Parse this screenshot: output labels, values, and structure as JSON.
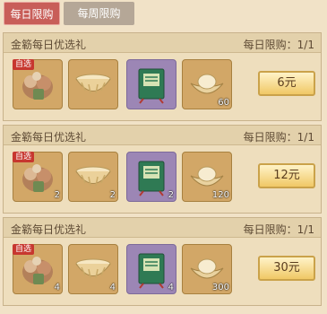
{
  "tabs": [
    {
      "label": "每日限购",
      "active": true
    },
    {
      "label": "每周限购",
      "active": false
    }
  ],
  "colors": {
    "accent": "#c85e59",
    "tab_inactive": "#b5a797",
    "badge": "#c7372f",
    "price_button": "#f0c866"
  },
  "packs": [
    {
      "title": "金簕每日优选礼",
      "limit": "每日限购：1/1",
      "price": "6元",
      "items": [
        {
          "name": "selection-bundle",
          "icon": "bundle-icon",
          "badge": "自选",
          "count": ""
        },
        {
          "name": "golden-bowl",
          "icon": "bowl-icon",
          "count": ""
        },
        {
          "name": "green-book",
          "icon": "book-icon",
          "count": ""
        },
        {
          "name": "gold-ingot",
          "icon": "ingot-icon",
          "count": "60"
        }
      ]
    },
    {
      "title": "金簕每日优选礼",
      "limit": "每日限购：1/1",
      "price": "12元",
      "items": [
        {
          "name": "selection-bundle",
          "icon": "bundle-icon",
          "badge": "自选",
          "count": "2"
        },
        {
          "name": "golden-bowl",
          "icon": "bowl-icon",
          "count": "2"
        },
        {
          "name": "green-book",
          "icon": "book-icon",
          "count": "2"
        },
        {
          "name": "gold-ingot",
          "icon": "ingot-icon",
          "count": "120"
        }
      ]
    },
    {
      "title": "金簕每日优选礼",
      "limit": "每日限购：1/1",
      "price": "30元",
      "items": [
        {
          "name": "selection-bundle",
          "icon": "bundle-icon",
          "badge": "自选",
          "count": "4"
        },
        {
          "name": "golden-bowl",
          "icon": "bowl-icon",
          "count": "4"
        },
        {
          "name": "green-book",
          "icon": "book-icon",
          "count": "4"
        },
        {
          "name": "gold-ingot",
          "icon": "ingot-icon",
          "count": "300"
        }
      ]
    }
  ]
}
